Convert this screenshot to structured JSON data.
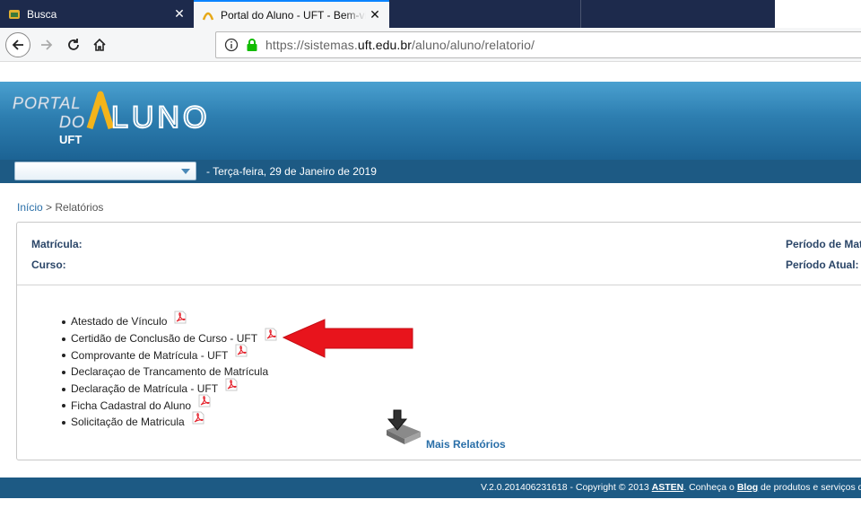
{
  "browser": {
    "tabs": [
      {
        "title": "Busca",
        "active": false
      },
      {
        "title": "Portal do Aluno - UFT - Bem-vindo",
        "active": true
      }
    ],
    "close_glyph": "✕",
    "url": {
      "prefix": "https://sistemas.",
      "domain": "uft.edu.br",
      "path": "/aluno/aluno/relatorio/"
    }
  },
  "header": {
    "logo_text_portal": "PORTAL",
    "logo_text_do": "DO",
    "logo_text_aluno": "ALUNO",
    "logo_sub": "UFT",
    "select_value": "",
    "date_text": "-    Terça-feira, 29 de Janeiro de 2019"
  },
  "breadcrumb": {
    "home": "Início",
    "separator": " > ",
    "current": "Relatórios"
  },
  "student_info": {
    "matricula_label": "Matrícula:",
    "curso_label": "Curso:",
    "periodo_label": "Período de Matr",
    "periodo_atual_label": "Período Atual:"
  },
  "reports": [
    {
      "label": "Atestado de Vínculo",
      "has_pdf": true
    },
    {
      "label": "Certidão de Conclusão de Curso - UFT",
      "has_pdf": true
    },
    {
      "label": "Comprovante de Matrícula - UFT",
      "has_pdf": true
    },
    {
      "label": "Declaraçao de Trancamento de Matrícula",
      "has_pdf": false
    },
    {
      "label": "Declaração de Matrícula - UFT",
      "has_pdf": true
    },
    {
      "label": "Ficha Cadastral do Aluno",
      "has_pdf": true
    },
    {
      "label": "Solicitação de Matricula",
      "has_pdf": true
    }
  ],
  "more_reports": "Mais Relatórios",
  "footer": {
    "version": "V.2.0.201406231618 - Copyright © 2013 ",
    "asten": "ASTEN",
    "middle": ". Conheça o ",
    "blog": "Blog",
    "tail": " de produtos e serviços d"
  },
  "colors": {
    "header_blue": "#1d5a84",
    "link_blue": "#2a6fa8",
    "arrow_red": "#e8141c",
    "label_navy": "#2b4668"
  }
}
